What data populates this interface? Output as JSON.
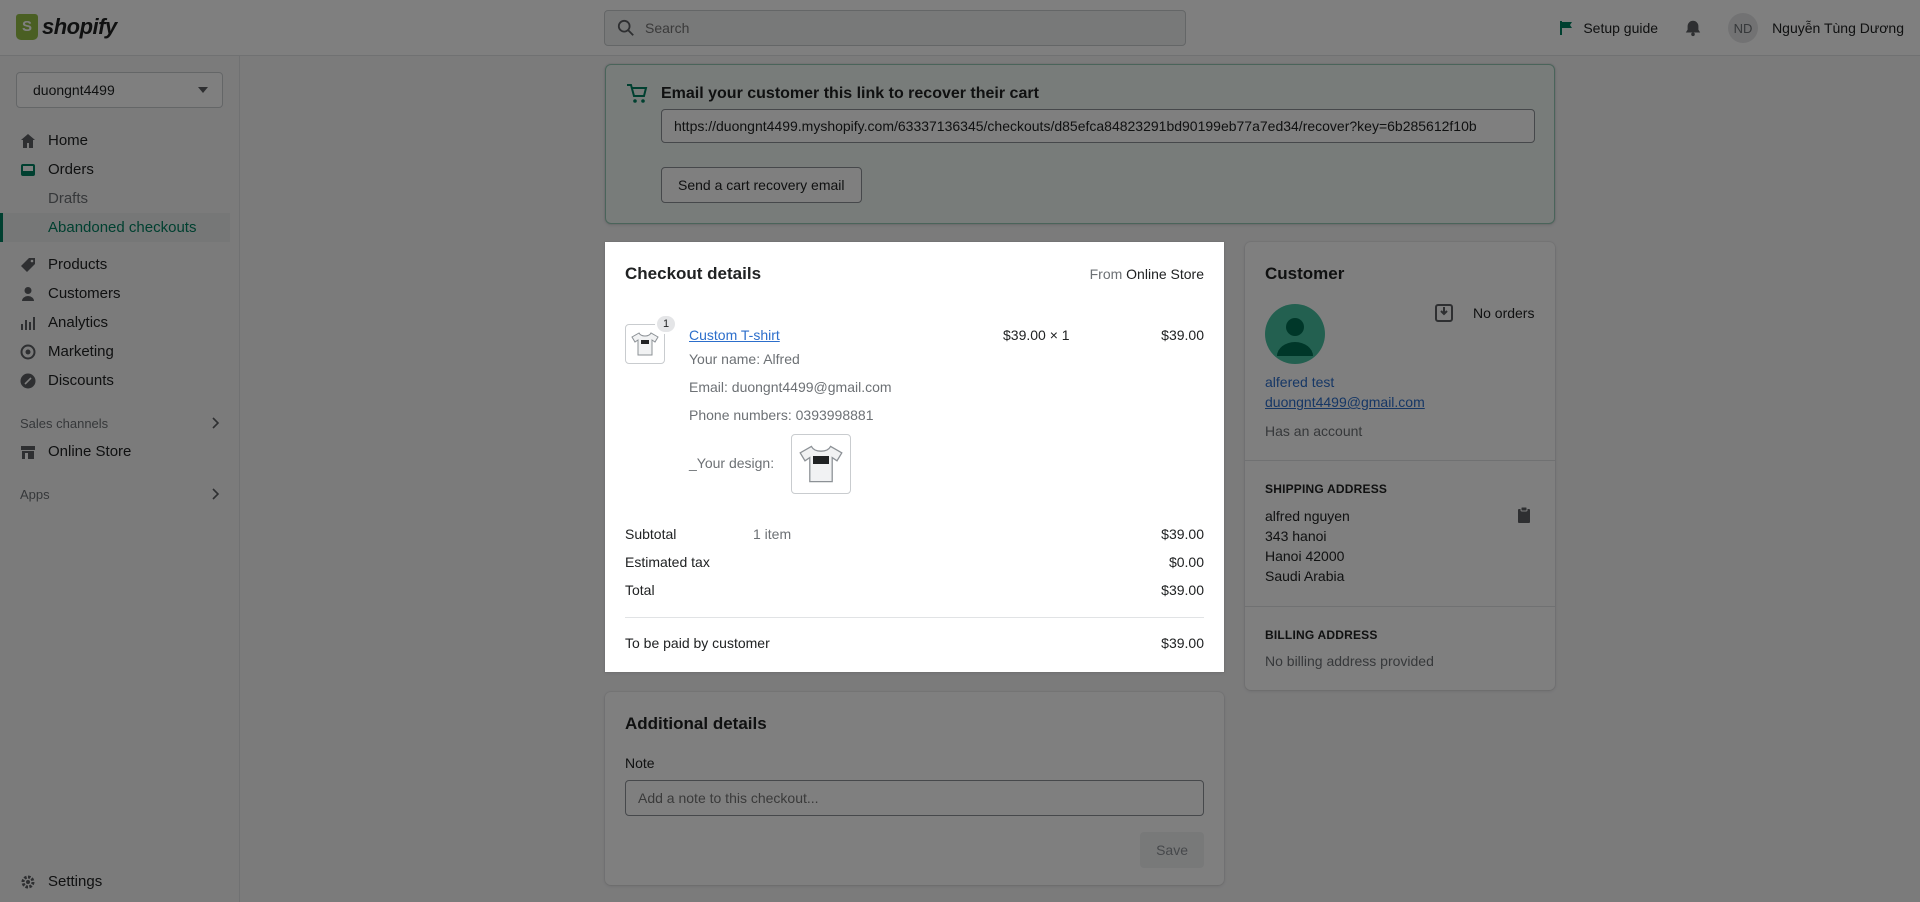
{
  "brand": {
    "name": "shopify"
  },
  "search": {
    "placeholder": "Search"
  },
  "header": {
    "setup_guide": "Setup guide",
    "user_initials": "ND",
    "user_name": "Nguyễn Tùng Dương"
  },
  "sidebar": {
    "store": "duongnt4499",
    "items": [
      {
        "label": "Home",
        "icon": "home-icon"
      },
      {
        "label": "Orders",
        "icon": "orders-icon"
      },
      {
        "label": "Drafts"
      },
      {
        "label": "Abandoned checkouts"
      },
      {
        "label": "Products",
        "icon": "tag-icon"
      },
      {
        "label": "Customers",
        "icon": "person-icon"
      },
      {
        "label": "Analytics",
        "icon": "analytics-icon"
      },
      {
        "label": "Marketing",
        "icon": "target-icon"
      },
      {
        "label": "Discounts",
        "icon": "discount-icon"
      }
    ],
    "sales_channels": "Sales channels",
    "online_store": "Online Store",
    "apps": "Apps",
    "settings": "Settings"
  },
  "recover": {
    "title": "Email your customer this link to recover their cart",
    "link": "https://duongnt4499.myshopify.com/63337136345/checkouts/d85efca84823291bd90199eb77a7ed34/recover?key=6b285612f10b",
    "button": "Send a cart recovery email"
  },
  "checkout": {
    "title": "Checkout details",
    "from_label": "From",
    "from_value": "Online Store",
    "item": {
      "qty_badge": "1",
      "name": "Custom T-shirt",
      "price_qty": "$39.00 × 1",
      "line_total": "$39.00",
      "props": [
        "Your name: Alfred",
        "Email: duongnt4499@gmail.com",
        "Phone numbers: 0393998881"
      ],
      "design_label": "_Your design:"
    },
    "subtotal_label": "Subtotal",
    "subtotal_items": "1 item",
    "subtotal": "$39.00",
    "tax_label": "Estimated tax",
    "tax": "$0.00",
    "total_label": "Total",
    "total": "$39.00",
    "paid_label": "To be paid by customer",
    "paid": "$39.00"
  },
  "customer": {
    "title": "Customer",
    "orders": "No orders",
    "name": "alfered test",
    "email": "duongnt4499@gmail.com",
    "account": "Has an account",
    "shipping_head": "SHIPPING ADDRESS",
    "shipping": [
      "alfred nguyen",
      "343 hanoi",
      "Hanoi 42000",
      "Saudi Arabia"
    ],
    "billing_head": "BILLING ADDRESS",
    "billing": "No billing address provided"
  },
  "additional": {
    "title": "Additional details",
    "note_label": "Note",
    "note_placeholder": "Add a note to this checkout...",
    "save": "Save"
  },
  "colors": {
    "accent": "#008060",
    "link": "#2c6ecb",
    "overlay": "rgba(0,0,0,0.5)"
  }
}
